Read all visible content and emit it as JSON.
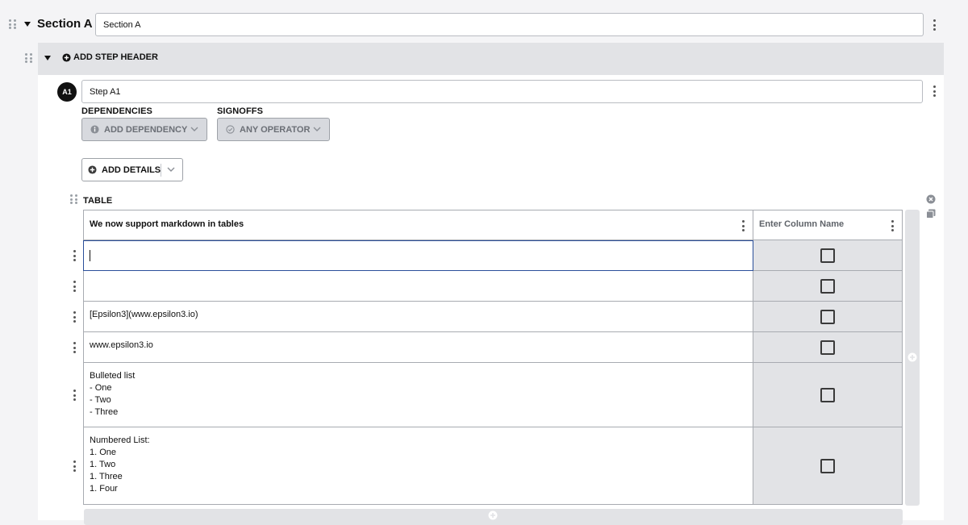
{
  "section": {
    "title": "Section A",
    "name_value": "Section A"
  },
  "header": {
    "add_step_header_label": "ADD STEP HEADER"
  },
  "step": {
    "badge": "A1",
    "name_value": "Step A1",
    "dependencies_label": "DEPENDENCIES",
    "signoffs_label": "SIGNOFFS",
    "add_dependency_label": "ADD DEPENDENCY",
    "any_operator_label": "ANY OPERATOR",
    "add_details_label": "ADD DETAILS"
  },
  "table": {
    "label": "TABLE",
    "columns": [
      "We now support markdown in tables",
      "Enter Column Name"
    ],
    "rows": [
      {
        "lines": [
          ""
        ],
        "active": true
      },
      {
        "lines": [
          ""
        ]
      },
      {
        "lines": [
          "[Epsilon3](www.epsilon3.io)"
        ]
      },
      {
        "lines": [
          "www.epsilon3.io"
        ]
      },
      {
        "lines": [
          "Bulleted list",
          "- One",
          "- Two",
          "- Three"
        ]
      },
      {
        "lines": [
          "Numbered List:",
          "1. One",
          "1. Two",
          "1. Three",
          "1. Four"
        ]
      }
    ]
  },
  "icons": {
    "caret": "caret-down-icon",
    "add": "plus-circle-icon",
    "info": "info-circle-icon",
    "check": "check-circle-icon",
    "close": "close-circle-icon",
    "copy": "copy-icon"
  },
  "colors": {
    "page_bg": "#f4f4f6",
    "header_bar": "#e2e3e6",
    "right_column_bg": "#e2e3e6",
    "active_cell_border": "#2a4f9a",
    "badge_bg": "#111111"
  }
}
